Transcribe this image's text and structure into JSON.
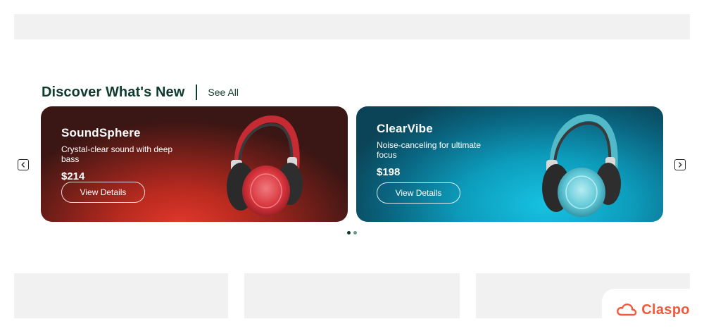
{
  "section": {
    "title": "Discover What's New",
    "see_all": "See All"
  },
  "carousel": {
    "slides_total": 2,
    "active_slide": 1
  },
  "cards": [
    {
      "name": "SoundSphere",
      "description": "Crystal-clear sound with deep bass",
      "price": "$214",
      "button": "View Details",
      "headphone_color": "#d8343c",
      "background_accent": "#e2382b"
    },
    {
      "name": "ClearVibe",
      "description": "Noise-canceling for ultimate focus",
      "price": "$198",
      "button": "View Details",
      "headphone_color": "#5ec7d6",
      "background_accent": "#17c2e2"
    }
  ],
  "brand": {
    "name": "Claspo",
    "color": "#ef5a3c",
    "icon": "cloud-logo-icon"
  },
  "colors": {
    "heading": "#0f3b2e",
    "placeholder": "#f0f1f0"
  }
}
